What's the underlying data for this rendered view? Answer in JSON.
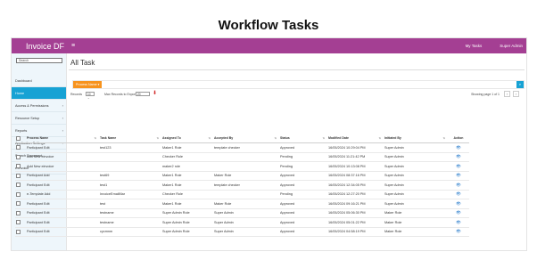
{
  "heading": "Workflow Tasks",
  "app": {
    "brand": "Invoice DF",
    "menu_glyph": "≡",
    "my_tasks": "My Tasks",
    "user": "Super Admin"
  },
  "sidebar": {
    "search_placeholder": "Search",
    "items": [
      {
        "label": "Dashboard",
        "chevron": ""
      },
      {
        "label": "Home",
        "chevron": ""
      },
      {
        "label": "Access & Permissions",
        "chevron": "›"
      },
      {
        "label": "Resource Setup",
        "chevron": "›"
      },
      {
        "label": "Reports",
        "chevron": "›"
      },
      {
        "label": "Application Settings",
        "chevron": "›"
      },
      {
        "label": "Search Document",
        "chevron": ""
      },
      {
        "label": "e-Invoice",
        "chevron": ""
      }
    ]
  },
  "main": {
    "title": "All Task",
    "process_button": "Process Name ▾",
    "search_button": "⌕",
    "records_label": "Records",
    "records_value": "10 ⌄",
    "max_records_label": "Max Records to Export",
    "max_records_value": "20",
    "pdf_glyph": "⬇",
    "paging": "Showing page 1 of 1",
    "prev": "‹",
    "next": "›"
  },
  "table": {
    "columns": [
      "Process Name",
      "Task Name",
      "Assigned To",
      "Accepted By",
      "Status",
      "Modified Date",
      "Initiated By",
      "Action"
    ],
    "sort_glyph": "⇅",
    "eye_glyph": "👁",
    "rows": [
      [
        "Participant Edit",
        "test123",
        "Maker1 Role",
        "template checker",
        "Approved",
        "16/05/2024 10:29:04 PM",
        "Super Admin"
      ],
      [
        "Add New einvoice",
        "",
        "Checker Role",
        "",
        "Pending",
        "16/05/2024 11:21:42 PM",
        "Super Admin"
      ],
      [
        "Add New einvoice",
        "",
        "maker2 role",
        "",
        "Pending",
        "16/05/2024 10:13:08 PM",
        "Super Admin"
      ],
      [
        "Participant Add",
        "test69",
        "Maker1 Role",
        "Maker Role",
        "Approved",
        "16/05/2024 08:37:16 PM",
        "Super Admin"
      ],
      [
        "Participant Edit",
        "test1",
        "Maker1 Role",
        "template checker",
        "Approved",
        "16/05/2024 12:34:05 PM",
        "Super Admin"
      ],
      [
        "e-Template Add",
        "InvoiceEmailMar",
        "Checker Role",
        "",
        "Pending",
        "16/05/2024 12:27:20 PM",
        "Super Admin"
      ],
      [
        "Participant Edit",
        "test",
        "Maker1 Role",
        "Maker Role",
        "Approved",
        "16/05/2024 09:16:21 PM",
        "Super Admin"
      ],
      [
        "Participant Edit",
        "testname",
        "Super Admin Role",
        "Super Admin",
        "Approved",
        "16/05/2024 05:06:30 PM",
        "Maker Role"
      ],
      [
        "Participant Edit",
        "testname",
        "Super Admin Role",
        "Super Admin",
        "Approved",
        "16/05/2024 05:01:22 PM",
        "Maker Role"
      ],
      [
        "Participant Edit",
        "cycmnm",
        "Super Admin Role",
        "Super Admin",
        "Approved",
        "16/05/2024 04:58:19 PM",
        "Maker Role"
      ]
    ]
  }
}
